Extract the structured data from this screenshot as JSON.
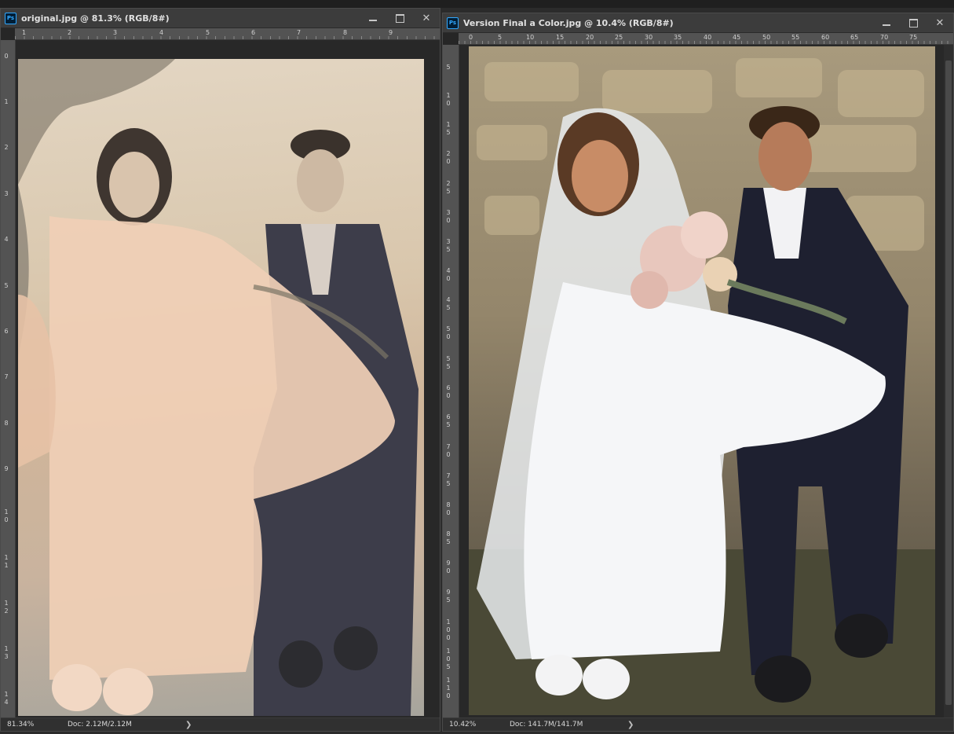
{
  "window_left": {
    "title": "original.jpg @ 81.3% (RGB/8#)",
    "ps_icon": "Ps",
    "zoom": "81.34%",
    "doc_info": "Doc: 2.12M/2.12M",
    "arrow": "❯",
    "ruler_h_labels": [
      "1",
      "2",
      "3",
      "4",
      "5",
      "6",
      "7",
      "8",
      "9"
    ],
    "ruler_v_labels": [
      "0",
      "1",
      "2",
      "3",
      "4",
      "5",
      "6",
      "7",
      "8",
      "9",
      "10",
      "11",
      "12",
      "13",
      "14"
    ],
    "image_icon": "photo-original-icon"
  },
  "window_right": {
    "title": "Version Final a Color.jpg @ 10.4% (RGB/8#)",
    "ps_icon": "Ps",
    "zoom": "10.42%",
    "doc_info": "Doc: 141.7M/141.7M",
    "arrow": "❯",
    "ruler_h_labels": [
      "0",
      "5",
      "10",
      "15",
      "20",
      "25",
      "30",
      "35",
      "40",
      "45",
      "50",
      "55",
      "60",
      "65",
      "70",
      "75"
    ],
    "ruler_v_labels": [
      "5",
      "10",
      "15",
      "20",
      "25",
      "30",
      "35",
      "40",
      "45",
      "50",
      "55",
      "60",
      "65",
      "70",
      "75",
      "80",
      "85",
      "90",
      "95",
      "100",
      "105",
      "110"
    ],
    "image_icon": "photo-colorized-icon"
  },
  "window_controls": {
    "minimize": "minimize-icon",
    "maximize": "maximize-icon",
    "close": "close-icon",
    "close_glyph": "✕"
  },
  "colors": {
    "accent": "#31a8ff",
    "chrome": "#3c3c3c",
    "canvas": "#282828"
  }
}
